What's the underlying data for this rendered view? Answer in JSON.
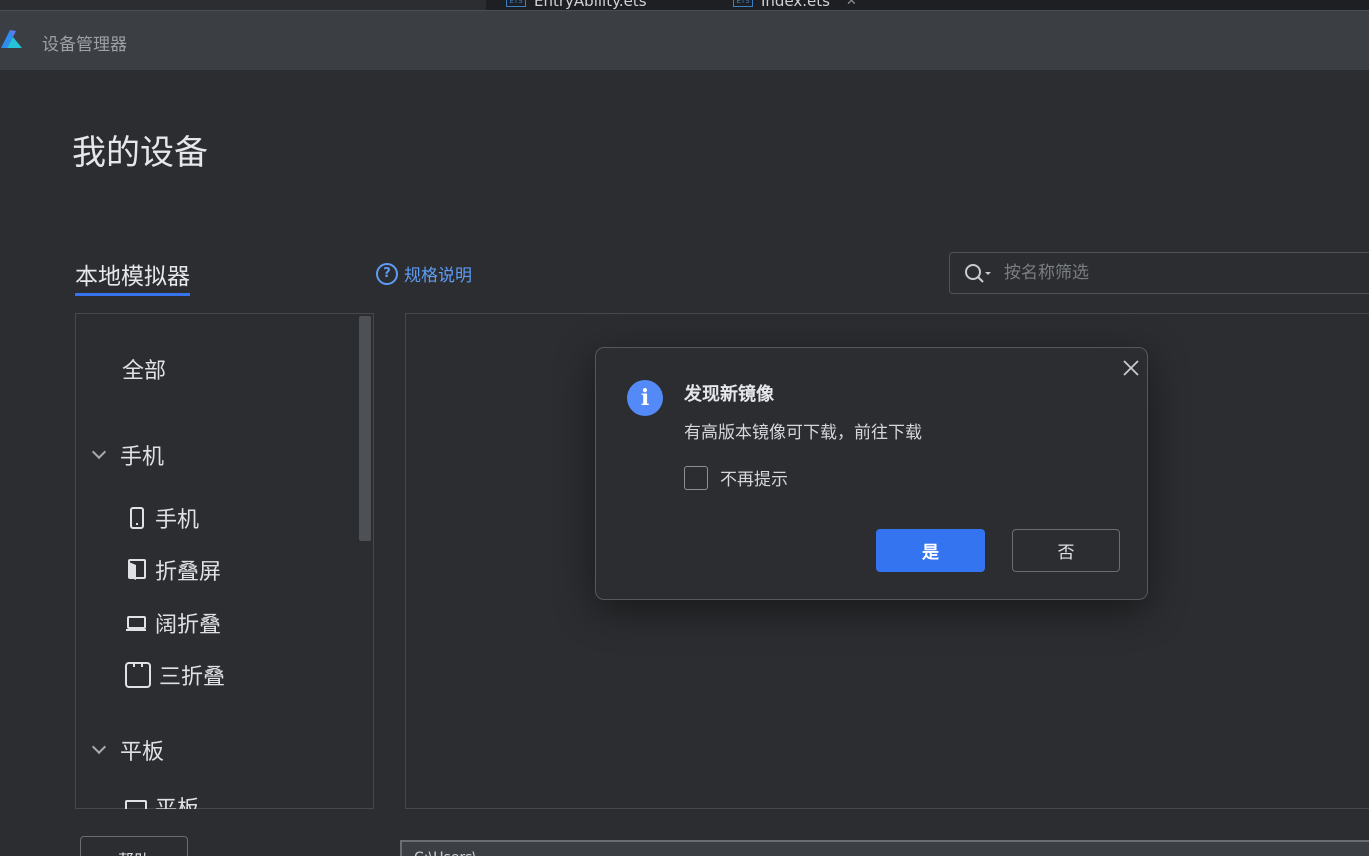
{
  "ide_tabs": [
    {
      "icon": "ets-file-icon",
      "label": "EntryAbility.ets"
    },
    {
      "icon": "ets-file-icon",
      "label": "Index.ets",
      "closable": true
    }
  ],
  "titlebar": {
    "logo": "app-logo-icon",
    "title": "设备管理器"
  },
  "page": {
    "title": "我的设备",
    "section_tab": "本地模拟器",
    "spec_link": "规格说明"
  },
  "search": {
    "icon": "search-icon",
    "placeholder": "按名称筛选",
    "value": ""
  },
  "categories": {
    "all": "全部",
    "phone_group": "手机",
    "phone_items": [
      {
        "icon": "phone-icon",
        "label": "手机"
      },
      {
        "icon": "foldable-icon",
        "label": "折叠屏"
      },
      {
        "icon": "wide-fold-icon",
        "label": "阔折叠"
      },
      {
        "icon": "tri-fold-icon",
        "label": "三折叠"
      }
    ],
    "tablet_group": "平板",
    "tablet_items": [
      {
        "icon": "tablet-icon",
        "label": "平板"
      }
    ]
  },
  "dialog": {
    "icon": "info-icon",
    "title": "发现新镜像",
    "message": "有高版本镜像可下载，前往下载",
    "checkbox_label": "不再提示",
    "checkbox_checked": false,
    "yes_label": "是",
    "no_label": "否"
  },
  "bottom": {
    "help_label": "帮助",
    "link_text": "...",
    "path_text": "C:\\Users\\..."
  },
  "colors": {
    "accent": "#3574f0",
    "link": "#5e9cf5",
    "background": "#2b2d30",
    "titlebar": "#3b3e43"
  }
}
